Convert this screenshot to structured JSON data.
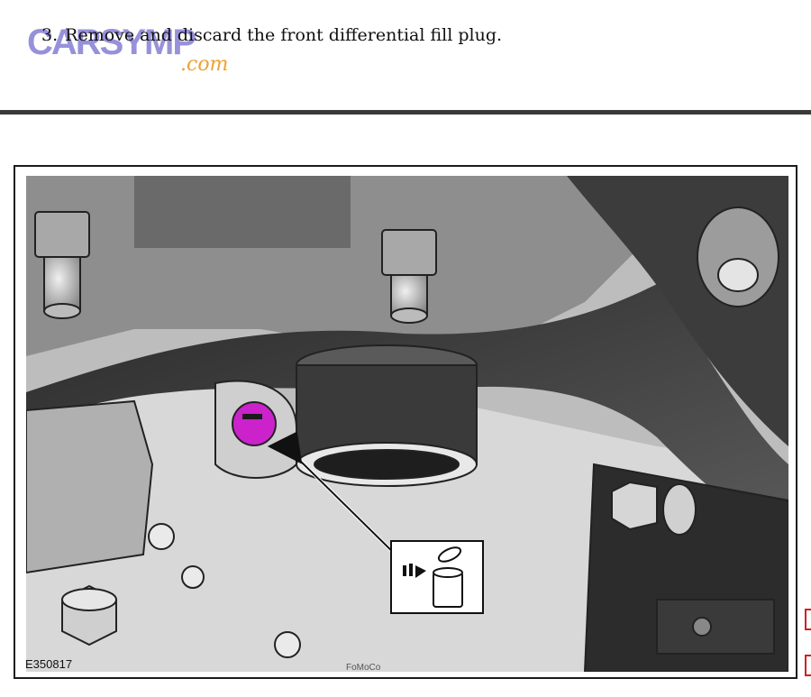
{
  "watermark": {
    "brand": "CARSYMP",
    "suffix": ".com"
  },
  "step": {
    "number": "3.",
    "text": "Remove and discard the front differential fill plug."
  },
  "figure": {
    "id": "E350817",
    "casting_mark": "FoMoCo",
    "callout_icon": "discard-bin-icon",
    "plug_icon": "fill-plug-icon",
    "highlight_color": "#cc22cc"
  }
}
